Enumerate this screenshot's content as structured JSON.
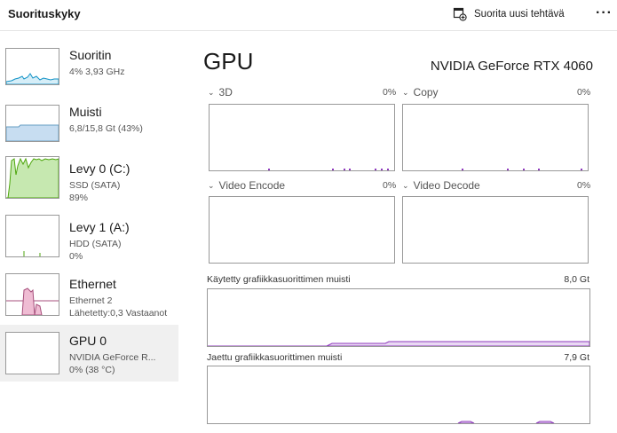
{
  "header": {
    "title": "Suorituskyky",
    "run_task_label": "Suorita uusi tehtävä",
    "more_label": "···"
  },
  "sidebar": {
    "items": [
      {
        "name": "Suoritin",
        "sub1": "4% 3,93 GHz",
        "sub2": ""
      },
      {
        "name": "Muisti",
        "sub1": "6,8/15,8 Gt (43%)",
        "sub2": ""
      },
      {
        "name": "Levy 0 (C:)",
        "sub1": "SSD (SATA)",
        "sub2": "89%"
      },
      {
        "name": "Levy 1 (A:)",
        "sub1": "HDD (SATA)",
        "sub2": "0%"
      },
      {
        "name": "Ethernet",
        "sub1": "Ethernet 2",
        "sub2": "Lähetetty:0,3 Vastaanot"
      },
      {
        "name": "GPU 0",
        "sub1": "NVIDIA GeForce R...",
        "sub2": "0%  (38 °C)"
      }
    ],
    "selected_index": 5
  },
  "main": {
    "title": "GPU",
    "model": "NVIDIA GeForce RTX 4060",
    "engines": [
      {
        "label": "3D",
        "percent": "0%"
      },
      {
        "label": "Copy",
        "percent": "0%"
      },
      {
        "label": "Video Encode",
        "percent": "0%"
      },
      {
        "label": "Video Decode",
        "percent": "0%"
      }
    ],
    "dedicated_memory": {
      "label": "Käytetty grafiikkasuorittimen muisti",
      "value": "8,0 Gt"
    },
    "shared_memory": {
      "label": "Jaettu grafiikkasuorittimen muisti",
      "value": "7,9 Gt"
    }
  },
  "colors": {
    "cpu": "#1192c6",
    "memory": "#669ec4",
    "disk": "#4da60c",
    "ethernet": "#a74f7c",
    "gpu": "#8e39bc"
  }
}
